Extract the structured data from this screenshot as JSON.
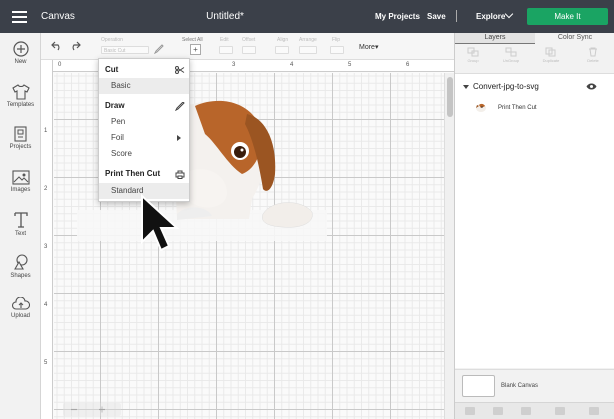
{
  "header": {
    "app_title": "Canvas",
    "doc_title": "Untitled*",
    "my_projects": "My Projects",
    "save": "Save",
    "explore": "Explore",
    "make_it": "Make It"
  },
  "sidebar": {
    "items": [
      {
        "label": "New",
        "icon": "plus-circle-icon"
      },
      {
        "label": "Templates",
        "icon": "shirt-icon"
      },
      {
        "label": "Projects",
        "icon": "projects-icon"
      },
      {
        "label": "Images",
        "icon": "image-icon"
      },
      {
        "label": "Text",
        "icon": "text-icon"
      },
      {
        "label": "Shapes",
        "icon": "shapes-icon"
      },
      {
        "label": "Upload",
        "icon": "cloud-upload-icon"
      }
    ]
  },
  "toolbar": {
    "faded_labels": [
      "Operation",
      "Select All",
      "Edit",
      "Offset",
      "Align",
      "Arrange",
      "Flip"
    ],
    "faded_values": [
      "Basic Cut"
    ],
    "select_all_label": "Select All",
    "more": "More▾"
  },
  "rulers": {
    "top": [
      "0",
      "1",
      "2",
      "3",
      "4",
      "5",
      "6"
    ],
    "left": [
      "1",
      "2",
      "3",
      "4",
      "5"
    ]
  },
  "menu": {
    "cut": "Cut",
    "basic": "Basic",
    "draw": "Draw",
    "pen": "Pen",
    "foil": "Foil",
    "score": "Score",
    "print_then_cut": "Print Then Cut",
    "standard": "Standard"
  },
  "right_panel": {
    "tabs": [
      "Layers",
      "Color Sync"
    ],
    "tools": [
      "Group",
      "UnGroup",
      "Duplicate",
      "Delete"
    ],
    "group_name": "Convert-jpg-to-svg",
    "layer_name": "Print Then Cut",
    "blank_canvas": "Blank Canvas"
  },
  "colors": {
    "topbar": "#3b4049",
    "make_it": "#1aa463",
    "sidebar": "#f2f2f2"
  }
}
